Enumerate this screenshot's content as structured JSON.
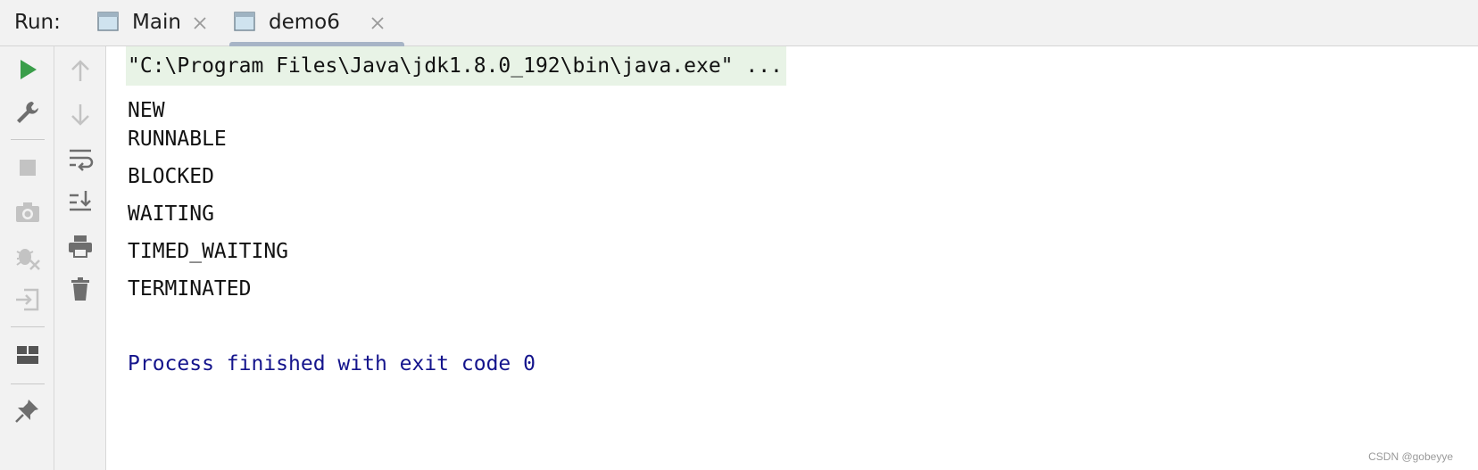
{
  "tabbar": {
    "run_label": "Run:",
    "tabs": [
      {
        "label": "Main",
        "active": false
      },
      {
        "label": "demo6",
        "active": true
      }
    ]
  },
  "toolbar_left": {
    "buttons": [
      "run-icon",
      "wrench-icon",
      "stop-icon",
      "camera-icon",
      "debug-exclude-icon",
      "import-icon",
      "layout-icon",
      "pin-icon"
    ]
  },
  "toolbar_right": {
    "buttons": [
      "arrow-up-icon",
      "arrow-down-icon",
      "soft-wrap-icon",
      "scroll-to-end-icon",
      "print-icon",
      "trash-icon"
    ]
  },
  "console": {
    "command": "\"C:\\Program Files\\Java\\jdk1.8.0_192\\bin\\java.exe\" ...",
    "lines": [
      "NEW",
      "RUNNABLE",
      "BLOCKED",
      "WAITING",
      "TIMED_WAITING",
      "TERMINATED"
    ],
    "exit_message": "Process finished with exit code 0"
  },
  "colors": {
    "run_green": "#3a9e4a",
    "command_bg": "#e8f3e6",
    "exit_text": "#14148c",
    "icon_gray": "#6e6e6e"
  },
  "watermark": "CSDN @gobeyye"
}
